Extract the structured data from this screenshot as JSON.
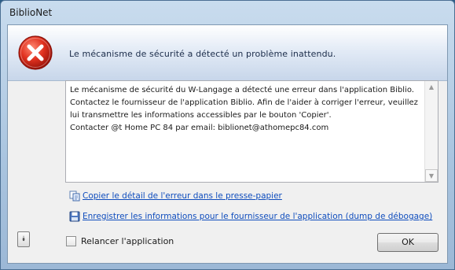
{
  "window": {
    "title": "BiblioNet"
  },
  "header": {
    "message": "Le mécanisme de sécurité a détecté un problème inattendu."
  },
  "details": {
    "text": "Le mécanisme de sécurité du W-Langage a détecté une erreur dans l'application Biblio.\nContactez le fournisseur de l'application Biblio. Afin de l'aider à corriger l'erreur, veuillez lui transmettre les informations accessibles par le bouton 'Copier'.\nContacter @t Home PC 84 par email: biblionet@athomepc84.com"
  },
  "links": {
    "copy_label": "Copier le détail de l'erreur dans le presse-papier",
    "save_label": "Enregistrer les informations pour le fournisseur de l'application (dump de débogage)"
  },
  "footer": {
    "restart_label": "Relancer l'application",
    "restart_checked": false,
    "ok_label": "OK"
  },
  "icons": {
    "error": "error-icon",
    "copy": "copy-icon",
    "save": "save-icon",
    "expand": "double-chevron-down-icon"
  },
  "colors": {
    "link": "#0f4dbd",
    "error_red": "#d32a1e"
  }
}
